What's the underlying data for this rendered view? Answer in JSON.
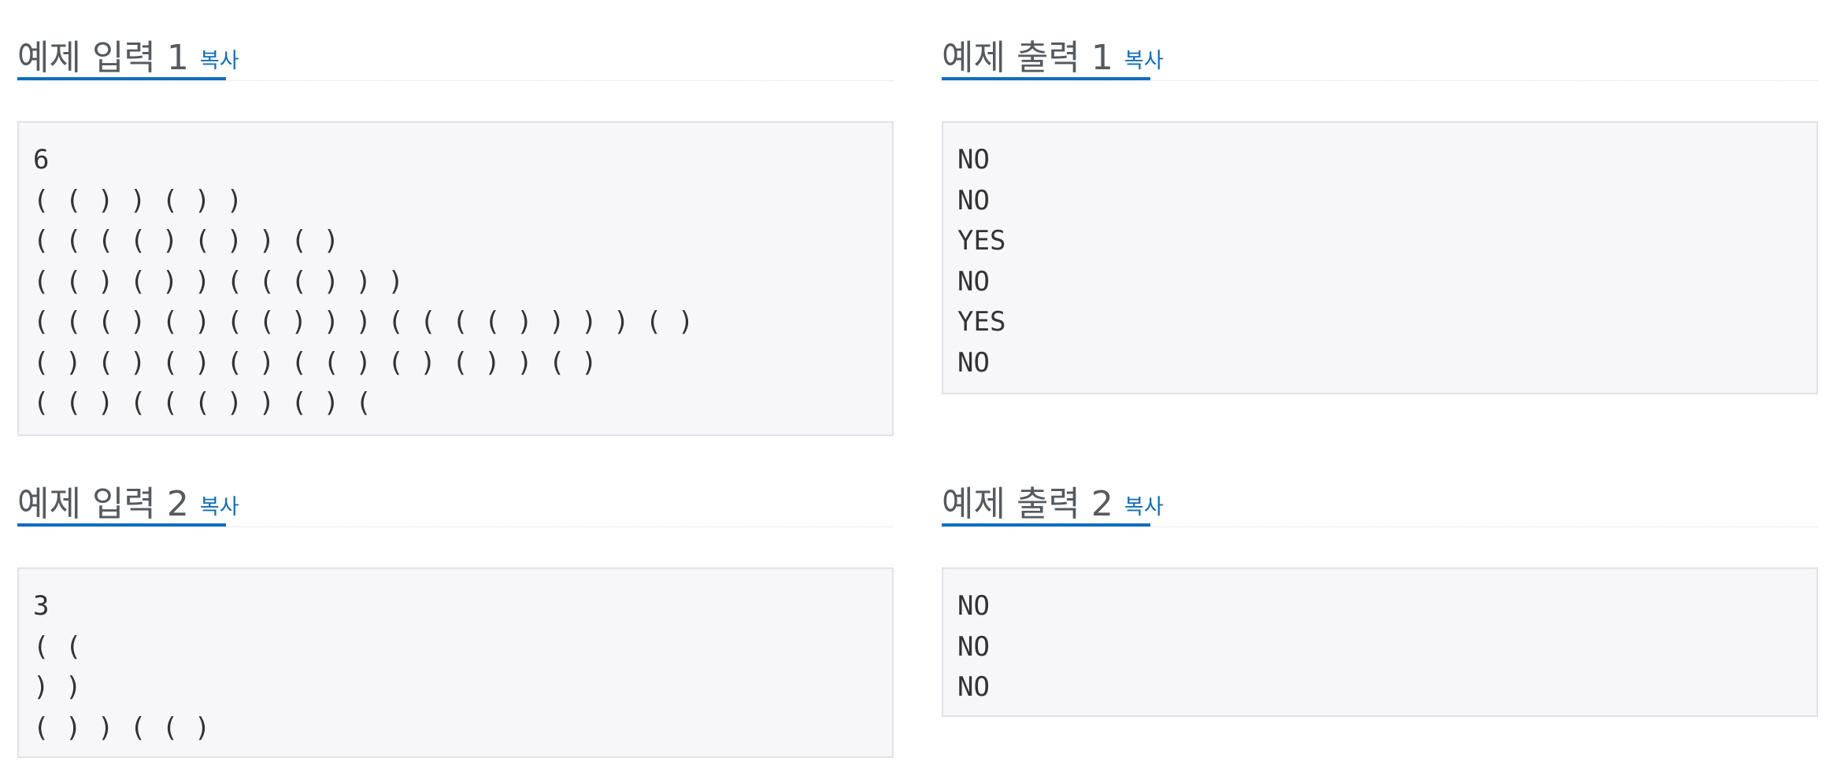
{
  "copy_label": "복사",
  "sections": {
    "input1": {
      "title": "예제 입력 1",
      "lines": "6\n( ( ) ) ( ) )\n( ( ( ( ) ( ) ) ( )\n( ( ) ( ) ) ( ( ( ) ) )\n( ( ( ) ( ) ( ( ) ) ) ( ( ( ( ) ) ) ) ( )\n( ) ( ) ( ) ( ) ( ( ) ( ) ( ) ) ( )\n( ( ) ( ( ( ) ) ( ) ("
    },
    "output1": {
      "title": "예제 출력 1",
      "lines": "NO\nNO\nYES\nNO\nYES\nNO"
    },
    "input2": {
      "title": "예제 입력 2",
      "lines": "3\n( (\n) )\n( ) ) ( ( )"
    },
    "output2": {
      "title": "예제 출력 2",
      "lines": "NO\nNO\nNO"
    }
  }
}
